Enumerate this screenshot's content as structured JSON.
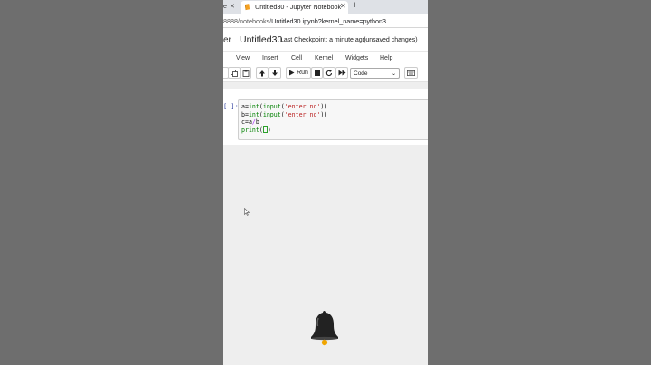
{
  "browser": {
    "prev_tab_text": "e",
    "tab": {
      "title": "Untitled30 - Jupyter Notebook",
      "close": "✕"
    },
    "new_tab": "+",
    "url_prefix": "8888/notebooks/",
    "url_rest": "Untitled30.ipynb?kernel_name=python3"
  },
  "header": {
    "logo_tail": "er",
    "notebook_name": "Untitled30",
    "checkpoint": "Last Checkpoint: a minute ago",
    "status": "(unsaved changes)"
  },
  "menu": {
    "items": [
      "View",
      "Insert",
      "Cell",
      "Kernel",
      "Widgets",
      "Help"
    ]
  },
  "toolbar": {
    "run_label": "Run",
    "cell_type": "Code"
  },
  "cell": {
    "prompt": "[ ]:",
    "lines": [
      "a=int(input('enter no'))",
      "b=int(input('enter no'))",
      "c=a/b",
      "print()"
    ]
  },
  "icons": {
    "tab_icon": "jupyter-book-icon",
    "bell": "notification-bell-icon"
  },
  "colors": {
    "prompt": "#303f9f",
    "keyword": "#008000",
    "string": "#ba2121"
  }
}
